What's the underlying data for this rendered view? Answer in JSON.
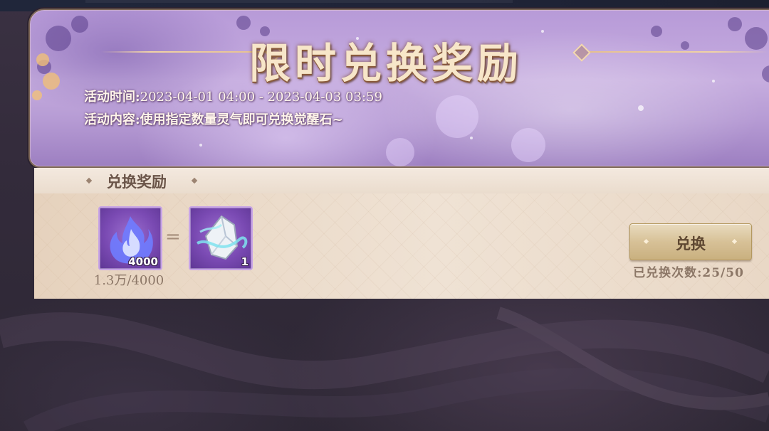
{
  "banner": {
    "title": "限时兑换奖励",
    "time_label": "活动时间:",
    "time_value": "2023-04-01 04:00 - 2023-04-03 03:59",
    "content_label": "活动内容:",
    "content_value": "使用指定数量灵气即可兑换觉醒石~"
  },
  "panel": {
    "header_title": "兑换奖励",
    "cost_item": {
      "icon": "purple-flame-icon",
      "count": "4000"
    },
    "equals": "=",
    "reward_item": {
      "icon": "awakening-stone-icon",
      "count": "1"
    },
    "owned_progress": "1.3万/4000",
    "exchange_button_label": "兑换",
    "exchange_count": "已兑换次数:25/50"
  },
  "colors": {
    "banner_title": "#f7e6c9",
    "panel_bg": "#e7d5c3",
    "item_bg": "#7a4ab3",
    "button_gold": "#d7c197",
    "muted_text": "#8c7767"
  }
}
